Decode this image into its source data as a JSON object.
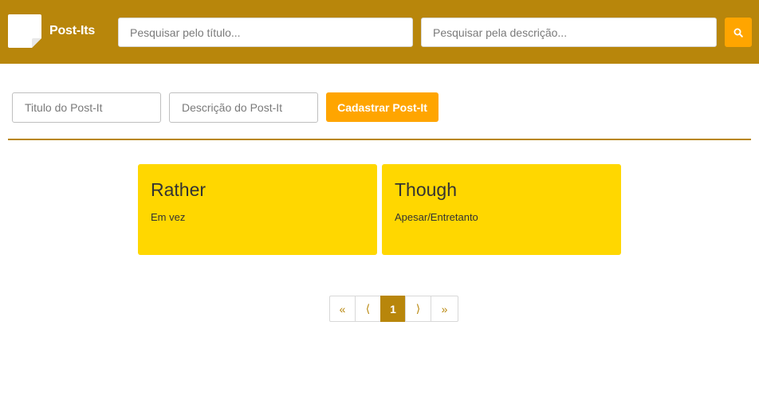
{
  "header": {
    "brand": "Post-Its",
    "search_title_placeholder": "Pesquisar pelo título...",
    "search_desc_placeholder": "Pesquisar pela descrição...",
    "search_button_icon": "search-icon"
  },
  "form": {
    "title_placeholder": "Titulo do Post-It",
    "desc_placeholder": "Descrição do Post-It",
    "submit_label": "Cadastrar Post-It"
  },
  "postits": [
    {
      "title": "Rather",
      "description": "Em vez"
    },
    {
      "title": "Though",
      "description": "Apesar/Entretanto"
    }
  ],
  "pagination": {
    "first": "«",
    "prev": "⟨",
    "current": "1",
    "next": "⟩",
    "last": "»"
  },
  "colors": {
    "header_bg": "#b8860b",
    "accent": "#ffa500",
    "postit_bg": "#ffd700"
  }
}
